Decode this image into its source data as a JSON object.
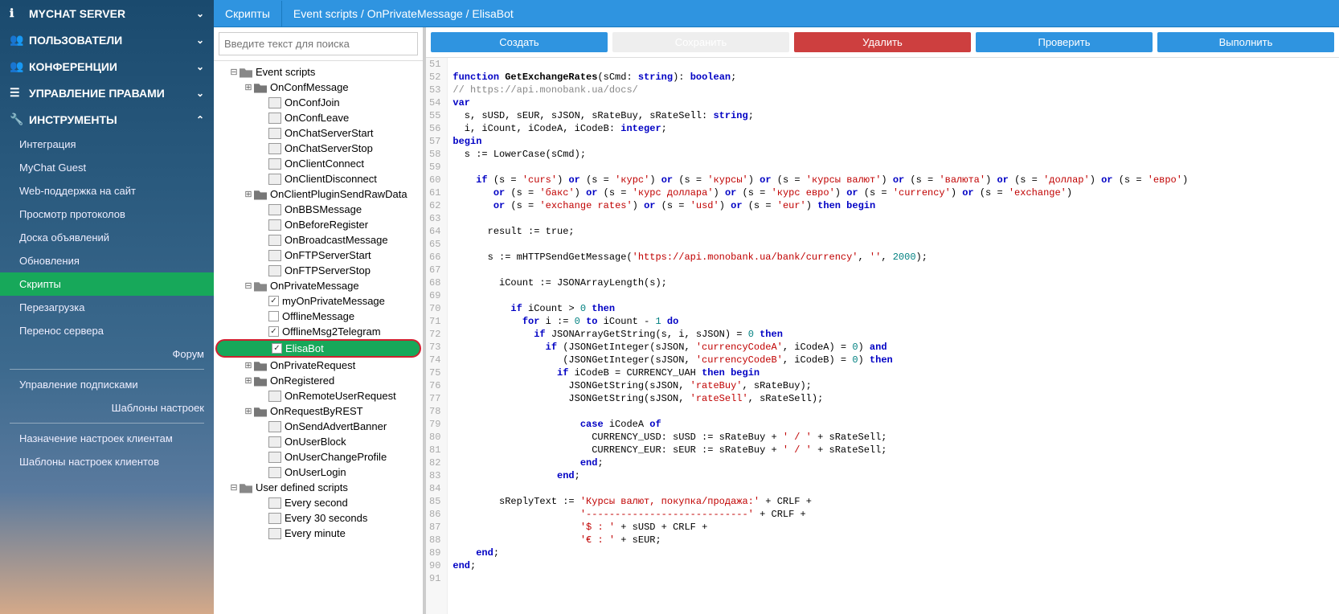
{
  "sidebar": {
    "sections": [
      {
        "icon": "ℹ",
        "label": "MYCHAT SERVER",
        "chevron": "⌄"
      },
      {
        "icon": "👥",
        "label": "ПОЛЬЗОВАТЕЛИ",
        "chevron": "⌄"
      },
      {
        "icon": "👥",
        "label": "КОНФЕРЕНЦИИ",
        "chevron": "⌄"
      },
      {
        "icon": "☰",
        "label": "УПРАВЛЕНИЕ ПРАВАМИ",
        "chevron": "⌄"
      },
      {
        "icon": "🔧",
        "label": "ИНСТРУМЕНТЫ",
        "chevron": "⌃",
        "expanded": true,
        "items": [
          {
            "label": "Интеграция"
          },
          {
            "label": "MyChat Guest"
          },
          {
            "label": "Web-поддержка на сайт"
          },
          {
            "label": "Просмотр протоколов"
          },
          {
            "label": "Доска объявлений"
          },
          {
            "label": "Обновления"
          },
          {
            "label": "Скрипты",
            "active": true
          },
          {
            "label": "Перезагрузка"
          },
          {
            "label": "Перенос сервера"
          },
          {
            "label": "Форум",
            "right": true
          },
          {
            "divider": true
          },
          {
            "label": "Управление подписками"
          },
          {
            "label": "Шаблоны настроек",
            "right": true
          },
          {
            "divider": true
          },
          {
            "label": "Назначение настроек клиентам"
          },
          {
            "label": "Шаблоны настроек клиентов"
          }
        ]
      }
    ]
  },
  "header": {
    "tab": "Скрипты",
    "breadcrumb": "Event scripts / OnPrivateMessage / ElisaBot"
  },
  "search": {
    "placeholder": "Введите текст для поиска"
  },
  "tree": [
    {
      "d": 1,
      "type": "folder-open",
      "exp": "⊟",
      "label": "Event scripts"
    },
    {
      "d": 2,
      "type": "folder",
      "exp": "⊞",
      "label": "OnConfMessage"
    },
    {
      "d": 3,
      "type": "file",
      "label": "OnConfJoin"
    },
    {
      "d": 3,
      "type": "file",
      "label": "OnConfLeave"
    },
    {
      "d": 3,
      "type": "file",
      "label": "OnChatServerStart"
    },
    {
      "d": 3,
      "type": "file",
      "label": "OnChatServerStop"
    },
    {
      "d": 3,
      "type": "file",
      "label": "OnClientConnect"
    },
    {
      "d": 3,
      "type": "file",
      "label": "OnClientDisconnect"
    },
    {
      "d": 2,
      "type": "folder",
      "exp": "⊞",
      "label": "OnClientPluginSendRawData"
    },
    {
      "d": 3,
      "type": "file",
      "label": "OnBBSMessage"
    },
    {
      "d": 3,
      "type": "file",
      "label": "OnBeforeRegister"
    },
    {
      "d": 3,
      "type": "file",
      "label": "OnBroadcastMessage"
    },
    {
      "d": 3,
      "type": "file",
      "label": "OnFTPServerStart"
    },
    {
      "d": 3,
      "type": "file",
      "label": "OnFTPServerStop"
    },
    {
      "d": 2,
      "type": "folder-open",
      "exp": "⊟",
      "label": "OnPrivateMessage"
    },
    {
      "d": 3,
      "type": "check",
      "checked": true,
      "label": "myOnPrivateMessage"
    },
    {
      "d": 3,
      "type": "check",
      "checked": false,
      "label": "OfflineMessage"
    },
    {
      "d": 3,
      "type": "check",
      "checked": true,
      "label": "OfflineMsg2Telegram"
    },
    {
      "d": 3,
      "type": "check",
      "checked": true,
      "label": "ElisaBot",
      "selected": true
    },
    {
      "d": 2,
      "type": "folder",
      "exp": "⊞",
      "label": "OnPrivateRequest"
    },
    {
      "d": 2,
      "type": "folder",
      "exp": "⊞",
      "label": "OnRegistered"
    },
    {
      "d": 3,
      "type": "file",
      "label": "OnRemoteUserRequest"
    },
    {
      "d": 2,
      "type": "folder",
      "exp": "⊞",
      "label": "OnRequestByREST"
    },
    {
      "d": 3,
      "type": "file",
      "label": "OnSendAdvertBanner"
    },
    {
      "d": 3,
      "type": "file",
      "label": "OnUserBlock"
    },
    {
      "d": 3,
      "type": "file",
      "label": "OnUserChangeProfile"
    },
    {
      "d": 3,
      "type": "file",
      "label": "OnUserLogin"
    },
    {
      "d": 1,
      "type": "folder-open",
      "exp": "⊟",
      "label": "User defined scripts"
    },
    {
      "d": 3,
      "type": "file",
      "label": "Every second"
    },
    {
      "d": 3,
      "type": "file",
      "label": "Every 30 seconds"
    },
    {
      "d": 3,
      "type": "file",
      "label": "Every minute"
    }
  ],
  "toolbar": {
    "create": "Создать",
    "save": "Сохранить",
    "delete": "Удалить",
    "check": "Проверить",
    "run": "Выполнить"
  },
  "code": {
    "start": 51,
    "lines": [
      "",
      "<span class='kw'>function</span> <span class='fn'>GetExchangeRates</span>(sCmd: <span class='typ'>string</span>): <span class='typ'>boolean</span>;",
      "<span class='cmnt'>// https://api.monobank.ua/docs/</span>",
      "<span class='kw'>var</span>",
      "  s, sUSD, sEUR, sJSON, sRateBuy, sRateSell: <span class='typ'>string</span>;",
      "  i, iCount, iCodeA, iCodeB: <span class='typ'>integer</span>;",
      "<span class='kw'>begin</span>",
      "  s := LowerCase(sCmd);",
      "",
      "    <span class='kw'>if</span> (s = <span class='str'>'curs'</span>) <span class='kw'>or</span> (s = <span class='str'>'курс'</span>) <span class='kw'>or</span> (s = <span class='str'>'курсы'</span>) <span class='kw'>or</span> (s = <span class='str'>'курсы валют'</span>) <span class='kw'>or</span> (s = <span class='str'>'валюта'</span>) <span class='kw'>or</span> (s = <span class='str'>'доллар'</span>) <span class='kw'>or</span> (s = <span class='str'>'евро'</span>)",
      "       <span class='kw'>or</span> (s = <span class='str'>'бакс'</span>) <span class='kw'>or</span> (s = <span class='str'>'курс доллара'</span>) <span class='kw'>or</span> (s = <span class='str'>'курс евро'</span>) <span class='kw'>or</span> (s = <span class='str'>'currency'</span>) <span class='kw'>or</span> (s = <span class='str'>'exchange'</span>)",
      "       <span class='kw'>or</span> (s = <span class='str'>'exchange rates'</span>) <span class='kw'>or</span> (s = <span class='str'>'usd'</span>) <span class='kw'>or</span> (s = <span class='str'>'eur'</span>) <span class='kw'>then begin</span>",
      "",
      "      result := true;",
      "",
      "      s := mHTTPSendGetMessage(<span class='str'>'https://api.monobank.ua/bank/currency'</span>, <span class='str'>''</span>, <span class='num'>2000</span>);",
      "",
      "        iCount := JSONArrayLength(s);",
      "",
      "          <span class='kw'>if</span> iCount &gt; <span class='num'>0</span> <span class='kw'>then</span>",
      "            <span class='kw'>for</span> i := <span class='num'>0</span> <span class='kw'>to</span> iCount - <span class='num'>1</span> <span class='kw'>do</span>",
      "              <span class='kw'>if</span> JSONArrayGetString(s, i, sJSON) = <span class='num'>0</span> <span class='kw'>then</span>",
      "                <span class='kw'>if</span> (JSONGetInteger(sJSON, <span class='str'>'currencyCodeA'</span>, iCodeA) = <span class='num'>0</span>) <span class='kw'>and</span>",
      "                   (JSONGetInteger(sJSON, <span class='str'>'currencyCodeB'</span>, iCodeB) = <span class='num'>0</span>) <span class='kw'>then</span>",
      "                  <span class='kw'>if</span> iCodeB = CURRENCY_UAH <span class='kw'>then begin</span>",
      "                    JSONGetString(sJSON, <span class='str'>'rateBuy'</span>, sRateBuy);",
      "                    JSONGetString(sJSON, <span class='str'>'rateSell'</span>, sRateSell);",
      "",
      "                      <span class='kw'>case</span> iCodeA <span class='kw'>of</span>",
      "                        CURRENCY_USD: sUSD := sRateBuy + <span class='str'>' / '</span> + sRateSell;",
      "                        CURRENCY_EUR: sEUR := sRateBuy + <span class='str'>' / '</span> + sRateSell;",
      "                      <span class='kw'>end</span>;",
      "                  <span class='kw'>end</span>;",
      "",
      "        sReplyText := <span class='str'>'Курсы валют, покупка/продажа:'</span> + CRLF +",
      "                      <span class='str'>'----------------------------'</span> + CRLF +",
      "                      <span class='str'>'$ : '</span> + sUSD + CRLF +",
      "                      <span class='str'>'€ : '</span> + sEUR;",
      "    <span class='kw'>end</span>;",
      "<span class='kw'>end</span>;",
      ""
    ]
  }
}
